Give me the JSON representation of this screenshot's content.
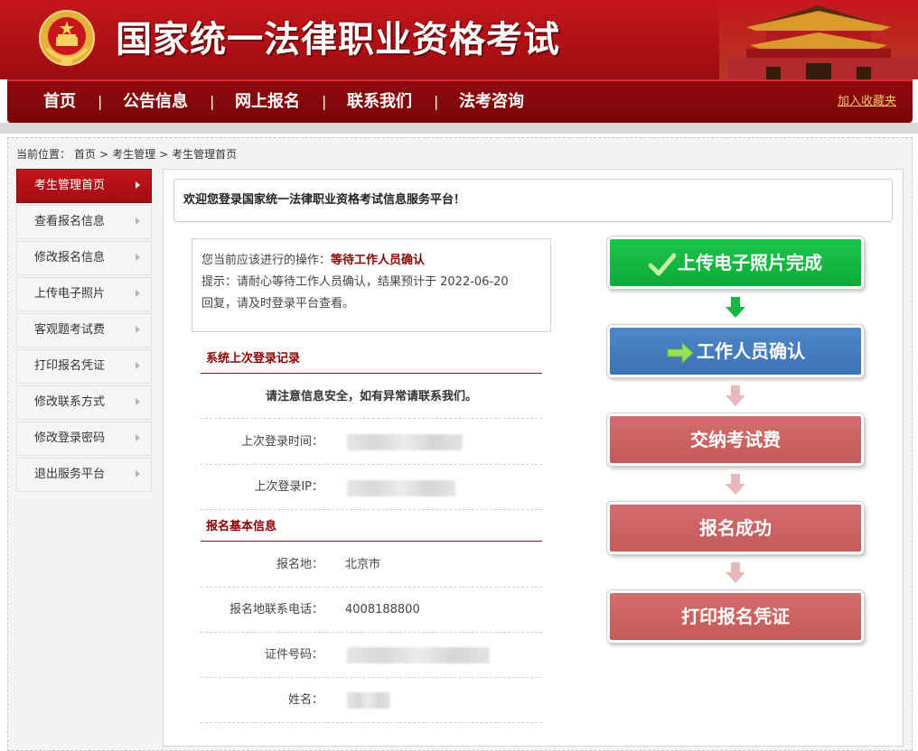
{
  "header": {
    "title": "国家统一法律职业资格考试"
  },
  "nav": {
    "items": [
      "首页",
      "公告信息",
      "网上报名",
      "联系我们",
      "法考咨询"
    ],
    "separator": "|",
    "bookmark": "加入收藏夹"
  },
  "breadcrumb": {
    "label": "当前位置：",
    "items": [
      "首页",
      ">",
      "考生管理",
      ">",
      "考生管理首页"
    ]
  },
  "sidebar": {
    "items": [
      "考生管理首页",
      "查看报名信息",
      "修改报名信息",
      "上传电子照片",
      "客观题考试费",
      "打印报名凭证",
      "修改联系方式",
      "修改登录密码",
      "退出服务平台"
    ],
    "active_index": 0
  },
  "welcome": "欢迎您登录国家统一法律职业资格考试信息服务平台！",
  "status": {
    "op_label": "您当前应该进行的操作：",
    "op_value": "等待工作人员确认",
    "hint_line1": "提示：请耐心等待工作人员确认，结果预计于 2022-06-20",
    "hint_line2": "回复，请及时登录平台查看。"
  },
  "login_record": {
    "title": "系统上次登录记录",
    "notice": "请注意信息安全，如有异常请联系我们。",
    "last_time_label": "上次登录时间：",
    "last_ip_label": "上次登录IP："
  },
  "basic_info": {
    "title": "报名基本信息",
    "place_label": "报名地：",
    "place_value": "北京市",
    "phone_label": "报名地联系电话：",
    "phone_value": "4008188800",
    "id_label": "证件号码：",
    "name_label": "姓名："
  },
  "flow": {
    "steps": [
      "上传电子照片完成",
      "工作人员确认",
      "交纳考试费",
      "报名成功",
      "打印报名凭证"
    ],
    "colors": {
      "done": "#14b842",
      "current": "#4a7fc1",
      "pending": "#cc6464"
    }
  },
  "colors": {
    "brand_red": "#b01116",
    "nav_dark": "#7a0508",
    "accent_text": "#8b0000",
    "bookmark": "#f3c86b"
  }
}
